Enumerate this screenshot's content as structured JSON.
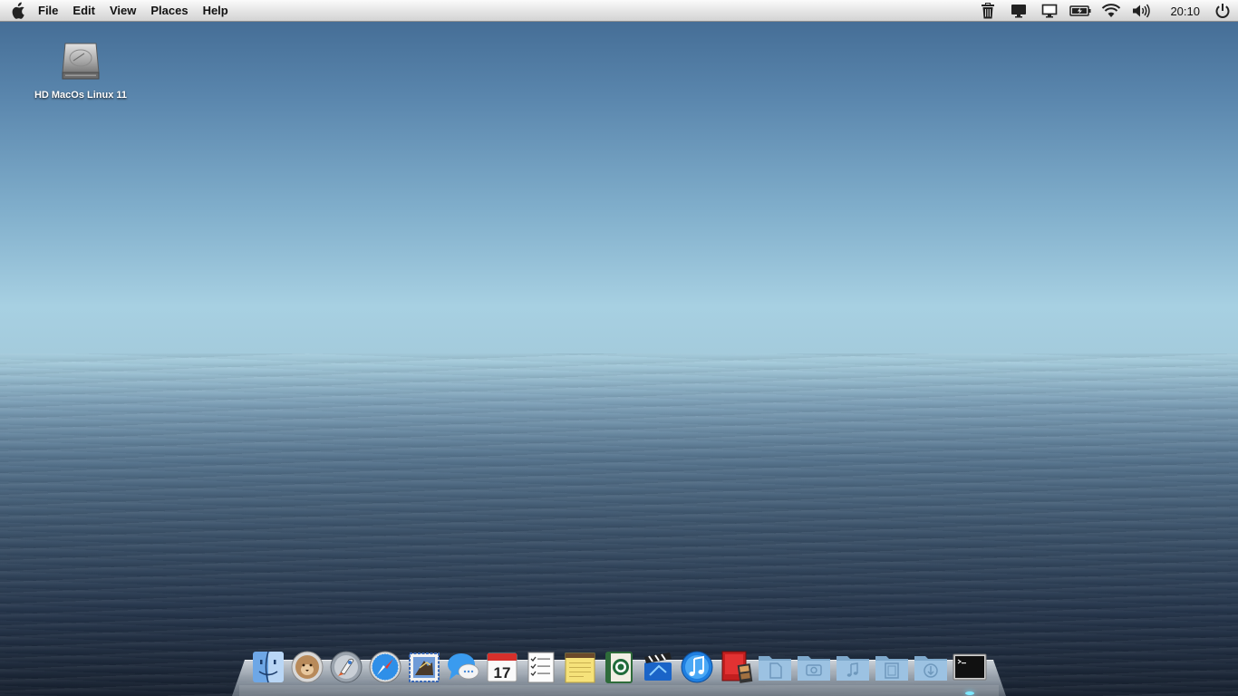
{
  "menubar": {
    "menus": [
      "File",
      "Edit",
      "View",
      "Places",
      "Help"
    ],
    "clock": "20:10"
  },
  "desktop": {
    "icons": [
      {
        "label": "HD MacOs Linux 11",
        "icon": "hard-drive-icon"
      }
    ]
  },
  "tray": [
    "trash-icon",
    "display-icon",
    "monitor-icon",
    "battery-icon",
    "wifi-icon",
    "volume-icon",
    "power-icon"
  ],
  "dock": {
    "items": [
      "finder-icon",
      "mountain-lion-icon",
      "launchpad-icon",
      "safari-icon",
      "mail-icon",
      "messages-icon",
      "calendar-icon",
      "reminders-icon",
      "notes-icon",
      "address-book-icon",
      "imovie-icon",
      "itunes-icon",
      "photo-booth-icon",
      "documents-folder-icon",
      "pictures-folder-icon",
      "music-folder-icon",
      "movies-folder-icon",
      "downloads-folder-icon",
      "terminal-icon"
    ],
    "calendar_day": "17"
  },
  "colors": {
    "menubar": "#e4e4e4",
    "folder": "#8fb8d8",
    "accent": "#2a7de1"
  }
}
